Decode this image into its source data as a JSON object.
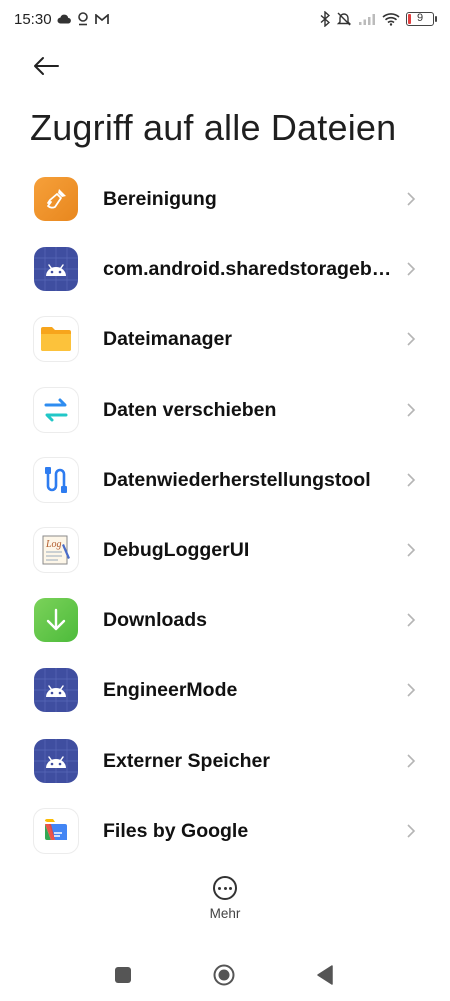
{
  "status_bar": {
    "time": "15:30",
    "battery_level": "9",
    "icons_left": [
      "cloud-icon",
      "location-icon",
      "gmail-icon"
    ],
    "icons_right": [
      "bluetooth-icon",
      "mute-icon",
      "signal-icon",
      "wifi-icon",
      "battery-icon"
    ]
  },
  "header": {
    "back_icon": "back-arrow-icon",
    "title": "Zugriff auf alle Dateien"
  },
  "apps": [
    {
      "label": "Bereinigung",
      "icon": "broom-icon",
      "color": "#f29a2e"
    },
    {
      "label": "com.android.sharedstoragebackup",
      "icon": "android-icon",
      "color": "#3f4ea0"
    },
    {
      "label": "Dateimanager",
      "icon": "folder-icon",
      "color": "#fbb128"
    },
    {
      "label": "Daten verschieben",
      "icon": "transfer-arrows-icon",
      "color": "#2e8cf0"
    },
    {
      "label": "Datenwiederherstellungstool",
      "icon": "cable-icon",
      "color": "#2e7cf0"
    },
    {
      "label": "DebugLoggerUI",
      "icon": "log-icon",
      "color": "#b05a2a"
    },
    {
      "label": "Downloads",
      "icon": "download-arrow-icon",
      "color": "#5cc645"
    },
    {
      "label": "EngineerMode",
      "icon": "android-icon",
      "color": "#3f4ea0"
    },
    {
      "label": "Externer Speicher",
      "icon": "android-icon",
      "color": "#3f4ea0"
    },
    {
      "label": "Files by Google",
      "icon": "files-google-icon",
      "color": "#4285f4"
    }
  ],
  "more": {
    "label": "Mehr",
    "icon": "more-dots-icon"
  },
  "nav_bar": {
    "buttons": [
      "recents-square-icon",
      "home-circle-icon",
      "back-triangle-icon"
    ]
  }
}
